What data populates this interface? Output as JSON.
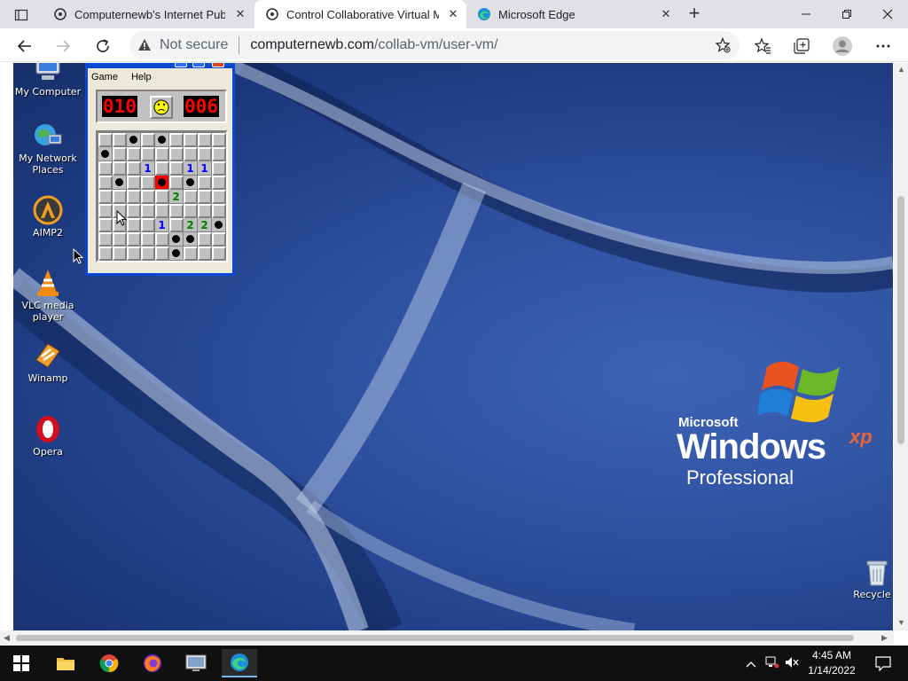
{
  "browser": {
    "tabs": [
      {
        "title": "Computernewb's Internet Pub H",
        "favicon": "vm-icon",
        "active": false
      },
      {
        "title": "Control Collaborative Virtual Ma",
        "favicon": "vm-icon",
        "active": true
      },
      {
        "title": "Microsoft Edge",
        "favicon": "edge-icon",
        "active": false
      }
    ],
    "close_glyph": "✕",
    "new_tab_glyph": "+",
    "security_label": "Not secure",
    "url_host": "computernewb.com",
    "url_path": "/collab-vm/user-vm/"
  },
  "desktop": {
    "icons": [
      {
        "label": "My Computer",
        "icon": "computer-icon"
      },
      {
        "label": "My Network Places",
        "icon": "network-icon"
      },
      {
        "label": "AIMP2",
        "icon": "aimp-icon"
      },
      {
        "label": "VLC media player",
        "icon": "vlc-icon"
      },
      {
        "label": "Winamp",
        "icon": "winamp-icon"
      },
      {
        "label": "Opera",
        "icon": "opera-icon"
      },
      {
        "label": "Recycle B",
        "icon": "recycle-bin-icon"
      }
    ],
    "logo": {
      "brand": "Microsoft",
      "product": "Windows",
      "edition_mark": "xp",
      "edition": "Professional"
    }
  },
  "minesweeper": {
    "menu": [
      "Game",
      "Help"
    ],
    "mines_left": "010",
    "timer": "006",
    "face": "dead",
    "board": [
      [
        "",
        "",
        "*",
        "",
        "*",
        "",
        "",
        "",
        ""
      ],
      [
        "*",
        "",
        "",
        "",
        "",
        "",
        "",
        "",
        ""
      ],
      [
        "",
        "",
        "",
        "1",
        "",
        "",
        "1",
        "1",
        ""
      ],
      [
        "",
        "*",
        "",
        "",
        "X",
        "",
        "*",
        "",
        ""
      ],
      [
        "",
        "",
        "",
        "",
        "",
        "2",
        "",
        "",
        ""
      ],
      [
        "",
        "",
        "",
        "",
        "",
        "",
        "",
        "",
        ""
      ],
      [
        "",
        "",
        "",
        "",
        "1",
        "",
        "2",
        "2",
        "*"
      ],
      [
        "",
        "",
        "",
        "",
        "",
        "*",
        "*",
        "",
        ""
      ],
      [
        "",
        "",
        "",
        "",
        "",
        "*",
        "",
        "",
        ""
      ]
    ]
  },
  "taskbar": {
    "apps": [
      "windows-start-icon",
      "file-explorer-icon",
      "chrome-icon",
      "firefox-icon",
      "vm-app-icon",
      "edge-icon"
    ],
    "time": "4:45 AM",
    "date": "1/14/2022"
  },
  "colors": {
    "xp_blue": "#0a48d8",
    "desktop_bg": "#2d4f9e",
    "taskbar": "#101010"
  }
}
